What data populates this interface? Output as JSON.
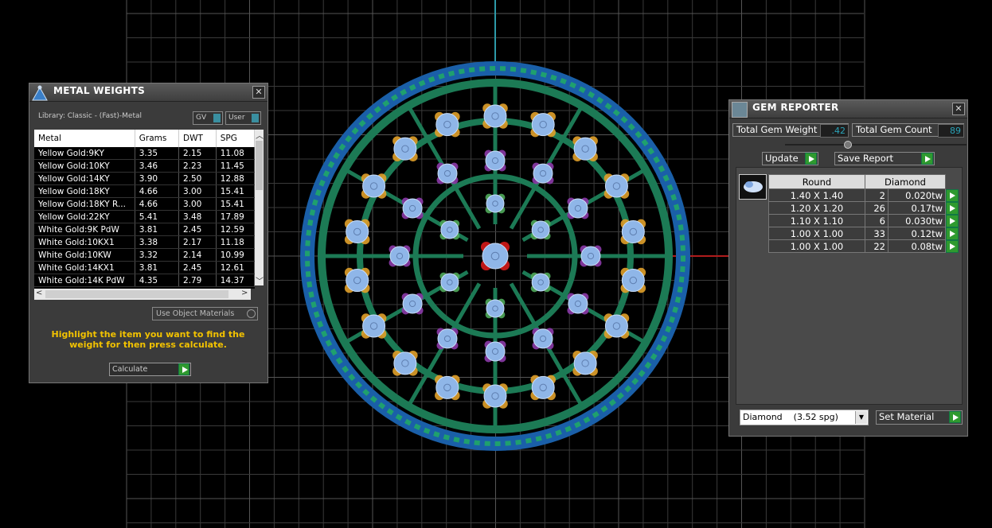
{
  "metal_weights": {
    "title": "METAL WEIGHTS",
    "library_label": "Library: Classic - (Fast)-Metal",
    "toggle_gv": "GV",
    "toggle_user": "User",
    "columns": [
      "Metal",
      "Grams",
      "DWT",
      "SPG"
    ],
    "rows": [
      [
        "Yellow Gold:9KY",
        "3.35",
        "2.15",
        "11.08"
      ],
      [
        "Yellow Gold:10KY",
        "3.46",
        "2.23",
        "11.45"
      ],
      [
        "Yellow Gold:14KY",
        "3.90",
        "2.50",
        "12.88"
      ],
      [
        "Yellow Gold:18KY",
        "4.66",
        "3.00",
        "15.41"
      ],
      [
        "Yellow Gold:18KY R...",
        "4.66",
        "3.00",
        "15.41"
      ],
      [
        "Yellow Gold:22KY",
        "5.41",
        "3.48",
        "17.89"
      ],
      [
        "White Gold:9K PdW",
        "3.81",
        "2.45",
        "12.59"
      ],
      [
        "White Gold:10KX1",
        "3.38",
        "2.17",
        "11.18"
      ],
      [
        "White Gold:10KW",
        "3.32",
        "2.14",
        "10.99"
      ],
      [
        "White Gold:14KX1",
        "3.81",
        "2.45",
        "12.61"
      ],
      [
        "White Gold:14K PdW",
        "4.35",
        "2.79",
        "14.37"
      ]
    ],
    "use_object_materials": "Use Object Materials",
    "hint": "Highlight the item you want to find the weight for then press calculate.",
    "calculate_label": "Calculate"
  },
  "gem_reporter": {
    "title": "GEM REPORTER",
    "total_weight_label": "Total Gem Weight",
    "total_weight_value": ".42",
    "total_count_label": "Total Gem Count",
    "total_count_value": "89",
    "update_label": "Update",
    "save_report_label": "Save Report",
    "table_headers": [
      "Round",
      "Diamond"
    ],
    "rows": [
      {
        "size": "1.40 X 1.40",
        "count": "2",
        "weight": "0.020tw"
      },
      {
        "size": "1.20 X 1.20",
        "count": "26",
        "weight": "0.17tw"
      },
      {
        "size": "1.10 X 1.10",
        "count": "6",
        "weight": "0.030tw"
      },
      {
        "size": "1.00 X 1.00",
        "count": "33",
        "weight": "0.12tw"
      },
      {
        "size": "1.00 X 1.00",
        "count": "22",
        "weight": "0.08tw"
      }
    ],
    "material_selected": "Diamond    (3.52 spg)",
    "set_material_label": "Set Material"
  },
  "colors": {
    "viewport_bg": "#000000",
    "grid_line": "#3a3a3a",
    "panel_bg": "#3b3b3b",
    "hint_text": "#f2c200",
    "value_text": "#2aa3b8",
    "play_green": "#2f9a2f",
    "ring_outer": "#1a5fa8",
    "ring_band": "#1c7a55",
    "gem_blue": "#8fb6e8",
    "prong_yellow": "#e0a02a",
    "prong_purple": "#8b3aa8",
    "prong_green": "#4fa85a",
    "center_red": "#d41a1a"
  }
}
